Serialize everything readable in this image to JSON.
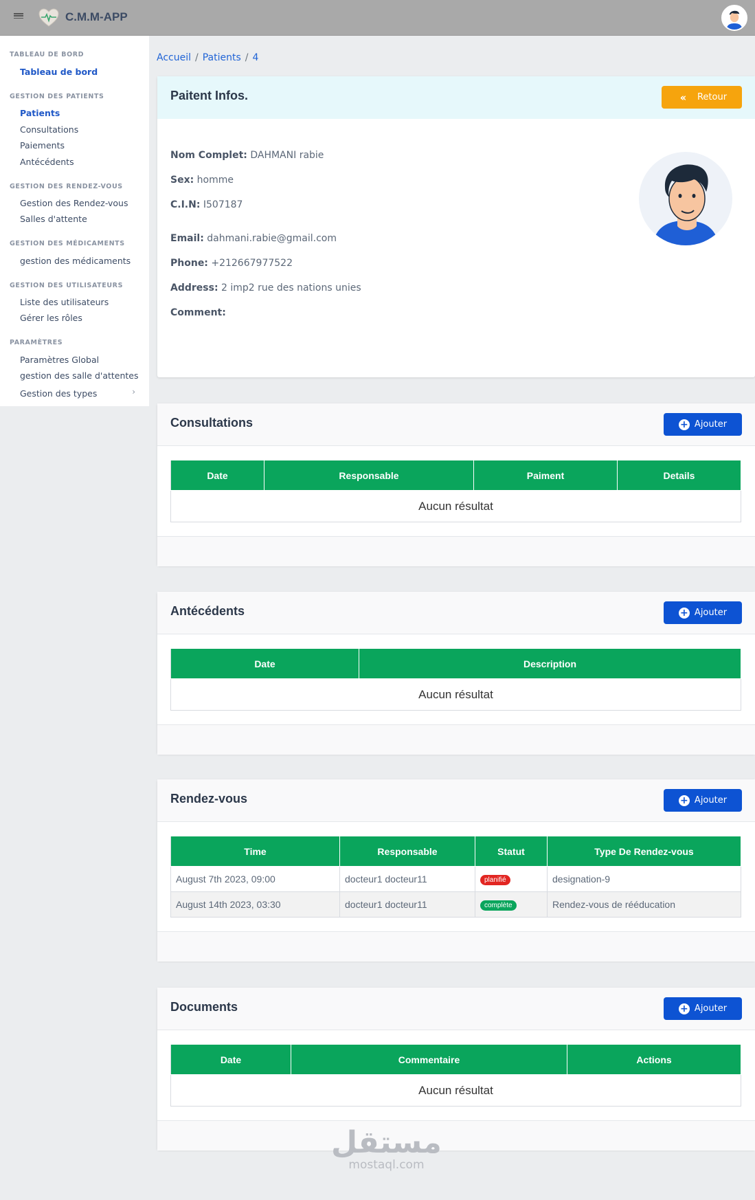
{
  "header": {
    "title": "C.M.M-APP",
    "menu_icon": "hamburger-icon",
    "logo_icon": "heart-pulse-icon",
    "avatar_icon": "user-avatar-icon"
  },
  "sidebar": {
    "sections": [
      {
        "title": "TABLEAU DE BORD",
        "items": [
          "Tableau de bord"
        ]
      },
      {
        "title": "GESTION DES PATIENTS",
        "items": [
          "Patients",
          "Consultations",
          "Paiements",
          "Antécédents"
        ]
      },
      {
        "title": "GESTION DES RENDEZ-VOUS",
        "items": [
          "Gestion des Rendez-vous",
          "Salles d'attente"
        ]
      },
      {
        "title": "GESTION DES MÉDICAMENTS",
        "items": [
          "gestion des médicaments"
        ]
      },
      {
        "title": "GESTION DES UTILISATEURS",
        "items": [
          "Liste des utilisateurs",
          "Gérer les rôles"
        ]
      },
      {
        "title": "PARAMÈTRES",
        "items": [
          "Paramètres Global",
          "gestion des salle d'attentes",
          "Gestion des types"
        ]
      }
    ],
    "chevron": "›"
  },
  "breadcrumb": {
    "home": "Accueil",
    "patients": "Patients",
    "id": "4",
    "sep": "/"
  },
  "patient_card": {
    "title": "Paitent Infos.",
    "back_label": "Retour",
    "fields": [
      {
        "label": "Nom Complet:",
        "value": "DAHMANI rabie"
      },
      {
        "label": "Sex:",
        "value": "homme"
      },
      {
        "label": "C.I.N:",
        "value": "I507187"
      },
      {
        "label": "Email:",
        "value": "dahmani.rabie@gmail.com"
      },
      {
        "label": "Phone:",
        "value": "+212667977522"
      },
      {
        "label": "Address:",
        "value": "2 imp2 rue des nations unies"
      },
      {
        "label": "Comment:",
        "value": ""
      }
    ]
  },
  "add_label": "Ajouter",
  "empty_label": "Aucun résultat",
  "consultations": {
    "title": "Consultations",
    "columns": [
      "Date",
      "Responsable",
      "Paiment",
      "Details"
    ]
  },
  "antecedents": {
    "title": "Antécédents",
    "columns": [
      "Date",
      "Description"
    ]
  },
  "rendezvous": {
    "title": "Rendez-vous",
    "columns": [
      "Time",
      "Responsable",
      "Statut",
      "Type De Rendez-vous"
    ],
    "rows": [
      {
        "time": "August 7th 2023, 09:00",
        "responsable": "docteur1 docteur11",
        "statut": "planifié",
        "statut_color": "#e22622",
        "type": "designation-9"
      },
      {
        "time": "August 14th 2023, 03:30",
        "responsable": "docteur1 docteur11",
        "statut": "complète",
        "statut_color": "#0aa55c",
        "type": "Rendez-vous de rééducation"
      }
    ]
  },
  "documents": {
    "title": "Documents",
    "columns": [
      "Date",
      "Commentaire",
      "Actions"
    ]
  },
  "watermark": {
    "arabic": "مستقل",
    "url": "mostaql.com"
  }
}
